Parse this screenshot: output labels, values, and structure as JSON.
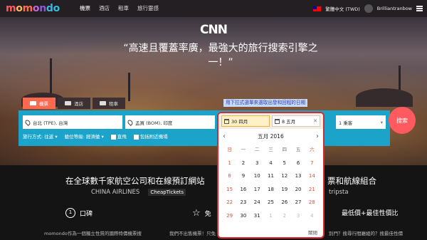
{
  "brand": {
    "logo_letters": [
      {
        "ch": "m",
        "color": "#ff5a5f"
      },
      {
        "ch": "o",
        "color": "#ffb65c"
      },
      {
        "ch": "m",
        "color": "#ff6e50"
      },
      {
        "ch": "o",
        "color": "#c367d5"
      },
      {
        "ch": "n",
        "color": "#8a5cd6"
      },
      {
        "ch": "d",
        "color": "#3db5e6"
      },
      {
        "ch": "o",
        "color": "#27c1e0"
      }
    ]
  },
  "nav": {
    "items": [
      {
        "label": "機票",
        "active": true
      },
      {
        "label": "酒店",
        "active": false
      },
      {
        "label": "租車",
        "active": false
      },
      {
        "label": "旅行靈感",
        "active": false
      }
    ]
  },
  "topright": {
    "language": "繁體中文 (TWD)",
    "username": "Brilliantranbow"
  },
  "hero": {
    "press_logo": "CNN",
    "quote": "“高速且覆蓋率廣，最強大的旅行搜索引擎之一！”"
  },
  "search": {
    "tabs": [
      {
        "label": "機票",
        "active": true
      },
      {
        "label": "酒店",
        "active": false
      },
      {
        "label": "租車",
        "active": false
      }
    ],
    "hint": "用下拉式選單來選取出發和回程的日期",
    "origin": "台北 (TPE), 台灣",
    "destination": "孟買 (BOM), 印度",
    "depart_date": "30 四月",
    "return_date": "8 五月",
    "passengers": "1 乘客",
    "trip_type": "旅行方式: 往返",
    "cabin_class": "艙位等級: 經濟艙",
    "direct_label": "直飛",
    "nearby_label": "包括附近機場",
    "search_button": "搜索",
    "accent": "#1ca3c9",
    "button_color": "#ff5a5f"
  },
  "calendar": {
    "month_title": "五月 2016",
    "weekdays": [
      "日",
      "一",
      "二",
      "三",
      "四",
      "五",
      "六"
    ],
    "weeks": [
      [
        "1",
        "2",
        "3",
        "4",
        "5",
        "6",
        "7"
      ],
      [
        "8",
        "9",
        "10",
        "11",
        "12",
        "13",
        "14"
      ],
      [
        "15",
        "16",
        "17",
        "18",
        "19",
        "20",
        "21"
      ],
      [
        "22",
        "23",
        "24",
        "25",
        "26",
        "27",
        "28"
      ],
      [
        "29",
        "30",
        "31",
        "1",
        "2",
        "3",
        "4"
      ]
    ],
    "close_label": "關閉",
    "highlight_border": "#d9282f"
  },
  "bottom": {
    "tagline_left": "在全球數千家航空公司和在線預訂網站",
    "tagline_right": "票和航線組合",
    "partners_left": [
      "CHINA AIRLINES",
      "CheapTickets"
    ],
    "partners_right": [
      "tripsta"
    ],
    "features": [
      {
        "num": "1",
        "title": "口碑"
      },
      {
        "num": "",
        "title": "免"
      },
      {
        "num": "",
        "title": "最低價+最佳性價比"
      }
    ],
    "descriptions": [
      "momondo作為一個獨立性質的國際特價機票搜",
      "我們不出售機票！只免",
      "別門？搜尋行間廳組的？搜最佳性價"
    ]
  }
}
